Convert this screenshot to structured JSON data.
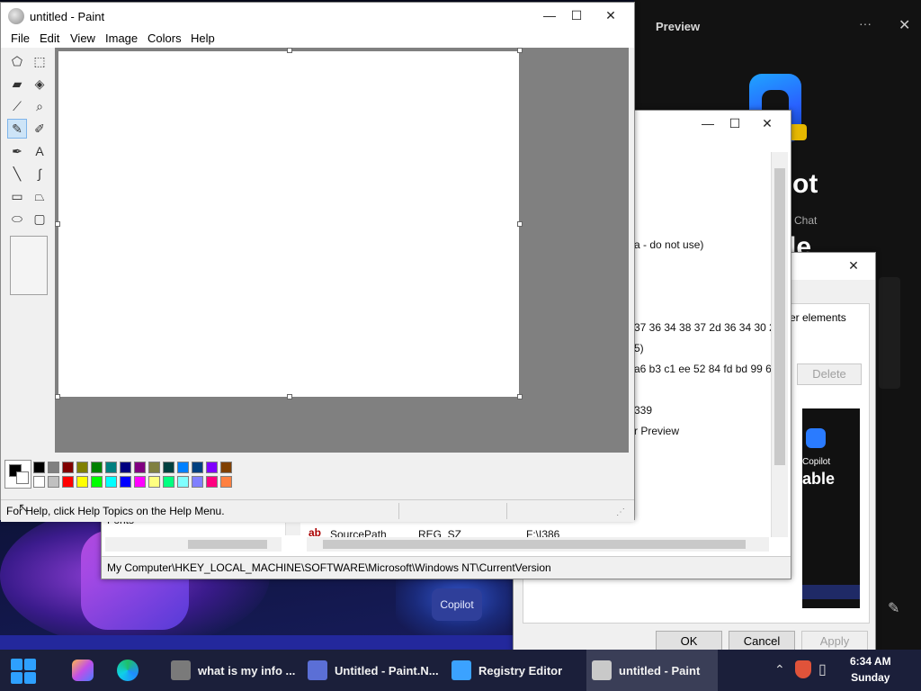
{
  "preview_pane": {
    "title": "Preview",
    "menu_glyph": "···",
    "close_glyph": "✕",
    "big_text_1": "ot",
    "small_text": "Chat",
    "big_text_2": "le"
  },
  "registry": {
    "title_buttons": {
      "minimize": "—",
      "maximize": "☐",
      "close": "✕"
    },
    "values": [
      "a - do not use)",
      "37 36 34 38 37 2d 36 34 30 2...",
      "5)",
      "a6 b3 c1 ee 52 84 fd bd 99 6...",
      "339",
      "r Preview"
    ],
    "tree_partial": "Fonts",
    "row_name": "SourcePath",
    "row_type": "REG_SZ",
    "row_data": "F:\\I386",
    "status_path": "My Computer\\HKEY_LOCAL_MACHINE\\SOFTWARE\\Microsoft\\Windows NT\\CurrentVersion"
  },
  "properties_dialog": {
    "close_glyph": "✕",
    "partial_text": "er elements",
    "delete_label": "Delete",
    "thumb_copilot": "Copilot",
    "thumb_big": "able",
    "ok_label": "OK",
    "cancel_label": "Cancel",
    "apply_label": "Apply"
  },
  "paint": {
    "title": "untitled - Paint",
    "title_buttons": {
      "minimize": "—",
      "maximize": "☐",
      "close": "✕"
    },
    "menu": [
      "File",
      "Edit",
      "View",
      "Image",
      "Colors",
      "Help"
    ],
    "tools": [
      {
        "name": "free-form-select-icon",
        "glyph": "⬠"
      },
      {
        "name": "rect-select-icon",
        "glyph": "⬚"
      },
      {
        "name": "eraser-icon",
        "glyph": "▰"
      },
      {
        "name": "fill-bucket-icon",
        "glyph": "◈"
      },
      {
        "name": "color-picker-icon",
        "glyph": "⟋"
      },
      {
        "name": "magnifier-icon",
        "glyph": "⌕"
      },
      {
        "name": "pencil-icon",
        "glyph": "✎"
      },
      {
        "name": "brush-icon",
        "glyph": "✐"
      },
      {
        "name": "airbrush-icon",
        "glyph": "✒"
      },
      {
        "name": "text-icon",
        "glyph": "A"
      },
      {
        "name": "line-icon",
        "glyph": "╲"
      },
      {
        "name": "curve-icon",
        "glyph": "∫"
      },
      {
        "name": "rectangle-icon",
        "glyph": "▭"
      },
      {
        "name": "polygon-icon",
        "glyph": "⏢"
      },
      {
        "name": "ellipse-icon",
        "glyph": "⬭"
      },
      {
        "name": "rounded-rect-icon",
        "glyph": "▢"
      }
    ],
    "selected_tool": "pencil-icon",
    "palette_top": [
      "#000000",
      "#808080",
      "#800000",
      "#808000",
      "#008000",
      "#008080",
      "#000080",
      "#800080",
      "#808040",
      "#004040",
      "#0080ff",
      "#004080",
      "#8000ff",
      "#804000"
    ],
    "palette_bottom": [
      "#ffffff",
      "#c0c0c0",
      "#ff0000",
      "#ffff00",
      "#00ff00",
      "#00ffff",
      "#0000ff",
      "#ff00ff",
      "#ffff80",
      "#00ff80",
      "#80ffff",
      "#8080ff",
      "#ff0080",
      "#ff8040"
    ],
    "status_text": "For Help, click Help Topics on the Help Menu."
  },
  "taskbar": {
    "items": [
      {
        "label": "what is my info ...",
        "icon": "browser-icon",
        "color": "#7a7a7a"
      },
      {
        "label": "Untitled - Paint.N...",
        "icon": "paint-net-icon",
        "color": "#5b6fd6"
      },
      {
        "label": "Registry Editor",
        "icon": "registry-icon",
        "color": "#3ba2ff"
      },
      {
        "label": "untitled - Paint",
        "icon": "paint-icon",
        "color": "#c9c9c9"
      }
    ],
    "time": "6:34 AM",
    "day": "Sunday"
  }
}
